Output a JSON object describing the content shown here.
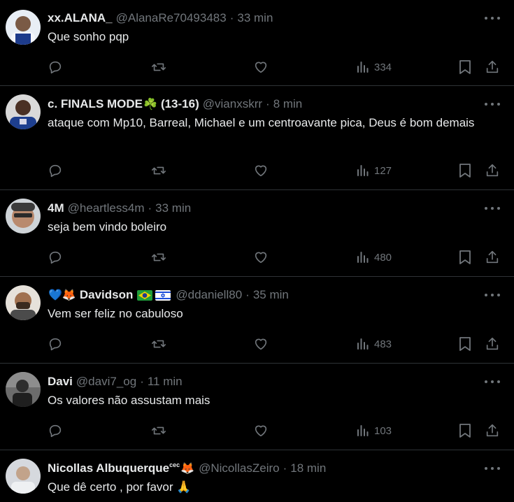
{
  "tweets": [
    {
      "name": "xx.ALANA_",
      "handle": "@AlanaRe70493483",
      "time": "33 min",
      "text": "Que sonho pqp",
      "views": "334"
    },
    {
      "name": "c. FINALS MODE",
      "name_emoji": "☘️",
      "name_suffix": "(13-16)",
      "handle": "@vianxskrr",
      "time": "8 min",
      "text": "ataque com Mp10, Barreal, Michael e um centroavante pica, Deus é bom demais",
      "views": "127"
    },
    {
      "name": "4M",
      "handle": "@heartless4m",
      "time": "33 min",
      "text": "seja bem vindo boleiro",
      "views": "480"
    },
    {
      "name_prefix_emoji": "💙🦊",
      "name": "Davidson",
      "name_flags": [
        "brazil-flag",
        "israel-flag"
      ],
      "handle": "@ddaniell80",
      "time": "35 min",
      "text": "Vem ser feliz no cabuloso",
      "views": "483"
    },
    {
      "name": "Davi",
      "handle": "@davi7_og",
      "time": "11 min",
      "text": "Os valores não assustam mais",
      "views": "103"
    },
    {
      "name": "Nicollas Albuquerque",
      "name_super": "cec",
      "name_emoji": "🦊",
      "handle": "@NicollasZeiro",
      "time": "18 min",
      "text": "Que dê certo , por favor 🙏"
    }
  ],
  "separator": "·",
  "colors": {
    "background": "#000000",
    "text": "#e7e9ea",
    "muted": "#71767b",
    "border": "#2f3336"
  }
}
